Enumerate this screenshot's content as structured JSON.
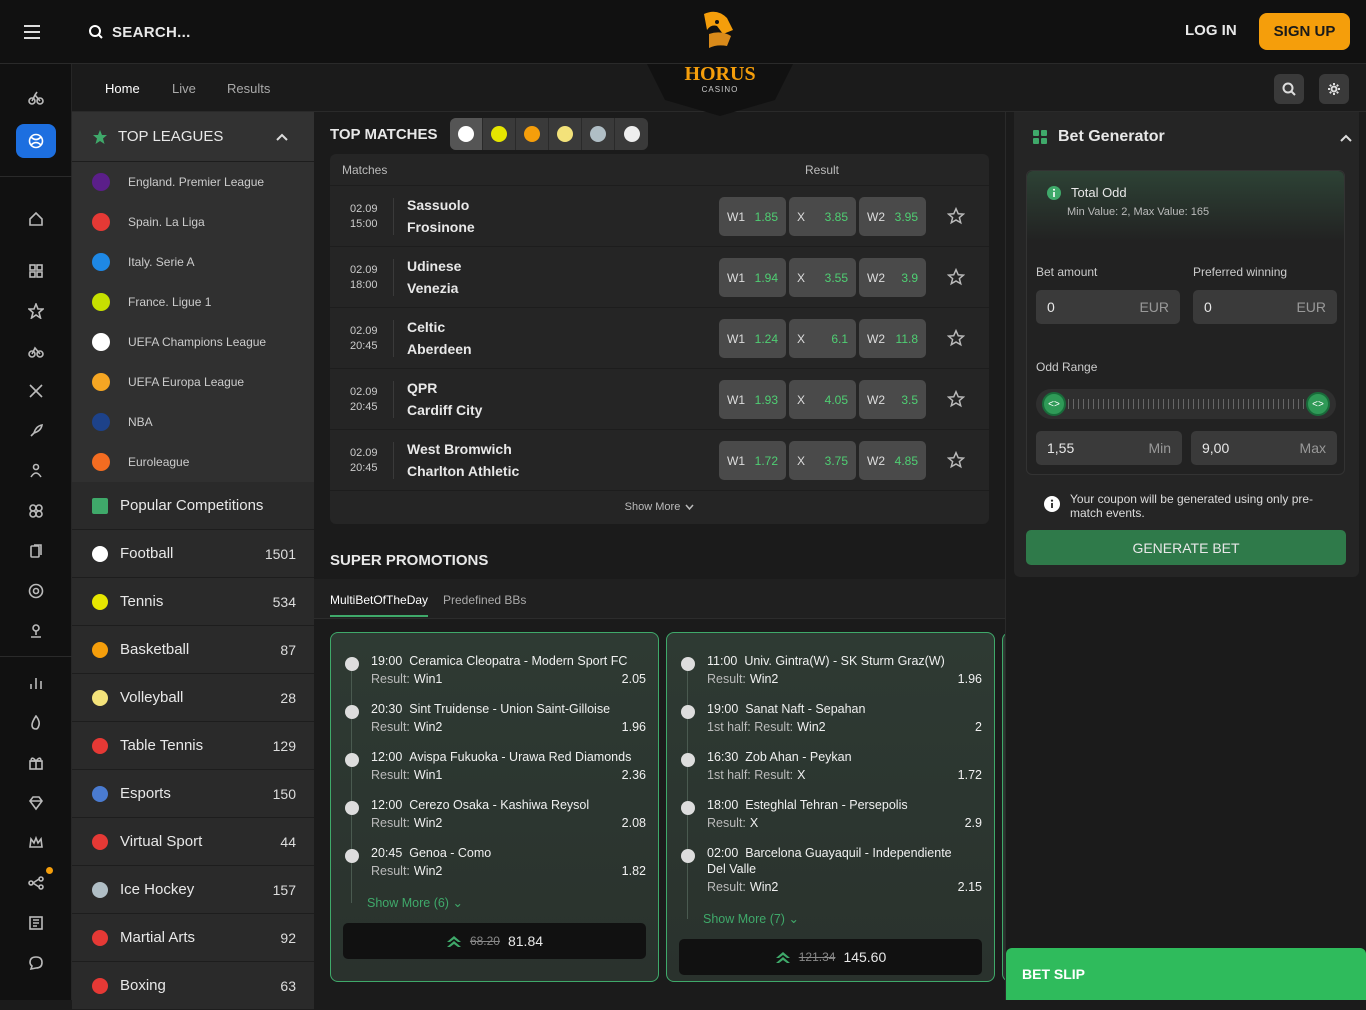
{
  "header": {
    "search_placeholder": "SEARCH...",
    "logo_text": "HORUS",
    "logo_sub": "CASINO",
    "login": "LOG IN",
    "signup": "SIGN UP"
  },
  "subnav": {
    "tabs": [
      "Home",
      "Live",
      "Results"
    ]
  },
  "top_leagues": {
    "title": "TOP LEAGUES",
    "items": [
      {
        "label": "England. Premier League",
        "color": "#5b1f8a"
      },
      {
        "label": "Spain. La Liga",
        "color": "#e53935"
      },
      {
        "label": "Italy. Serie A",
        "color": "#1e88e5"
      },
      {
        "label": "France. Ligue 1",
        "color": "#c6e000"
      },
      {
        "label": "UEFA Champions League",
        "color": "#ffffff"
      },
      {
        "label": "UEFA Europa League",
        "color": "#f5a623"
      },
      {
        "label": "NBA",
        "color": "#1d428a"
      },
      {
        "label": "Euroleague",
        "color": "#f36c21"
      }
    ]
  },
  "categories": [
    {
      "label": "Popular Competitions",
      "count": "",
      "color": "#3fa96a"
    },
    {
      "label": "Football",
      "count": "1501",
      "color": "#ffffff"
    },
    {
      "label": "Tennis",
      "count": "534",
      "color": "#e6e600"
    },
    {
      "label": "Basketball",
      "count": "87",
      "color": "#f59e0b"
    },
    {
      "label": "Volleyball",
      "count": "28",
      "color": "#f3e27a"
    },
    {
      "label": "Table Tennis",
      "count": "129",
      "color": "#e53935"
    },
    {
      "label": "Esports",
      "count": "150",
      "color": "#4a7bd0"
    },
    {
      "label": "Virtual Sport",
      "count": "44",
      "color": "#e53935"
    },
    {
      "label": "Ice Hockey",
      "count": "157",
      "color": "#b0bec5"
    },
    {
      "label": "Martial Arts",
      "count": "92",
      "color": "#e53935"
    },
    {
      "label": "Boxing",
      "count": "63",
      "color": "#e53935"
    }
  ],
  "top_matches": {
    "title": "TOP MATCHES",
    "col_matches": "Matches",
    "col_result": "Result",
    "show_more": "Show More",
    "matches": [
      {
        "date": "02.09",
        "time": "15:00",
        "home": "Sassuolo",
        "away": "Frosinone",
        "w1": "1.85",
        "x": "3.85",
        "w2": "3.95"
      },
      {
        "date": "02.09",
        "time": "18:00",
        "home": "Udinese",
        "away": "Venezia",
        "w1": "1.94",
        "x": "3.55",
        "w2": "3.9"
      },
      {
        "date": "02.09",
        "time": "20:45",
        "home": "Celtic",
        "away": "Aberdeen",
        "w1": "1.24",
        "x": "6.1",
        "w2": "11.8"
      },
      {
        "date": "02.09",
        "time": "20:45",
        "home": "QPR",
        "away": "Cardiff City",
        "w1": "1.93",
        "x": "4.05",
        "w2": "3.5"
      },
      {
        "date": "02.09",
        "time": "20:45",
        "home": "West Bromwich",
        "away": "Charlton Athletic",
        "w1": "1.72",
        "x": "3.75",
        "w2": "4.85"
      }
    ],
    "labels": {
      "w1": "W1",
      "x": "X",
      "w2": "W2"
    }
  },
  "promotions": {
    "title": "SUPER PROMOTIONS",
    "tabs": [
      "MultiBetOfTheDay",
      "Predefined BBs"
    ],
    "result_label": "Result:",
    "half_label": "1st half: Result:",
    "cards": [
      {
        "items": [
          {
            "time": "19:00",
            "match": "Ceramica Cleopatra - Modern Sport FC",
            "kind": "Result:",
            "pick": "Win1",
            "odd": "2.05"
          },
          {
            "time": "20:30",
            "match": "Sint Truidense - Union Saint-Gilloise",
            "kind": "Result:",
            "pick": "Win2",
            "odd": "1.96"
          },
          {
            "time": "12:00",
            "match": "Avispa Fukuoka - Urawa Red Diamonds",
            "kind": "Result:",
            "pick": "Win1",
            "odd": "2.36"
          },
          {
            "time": "12:00",
            "match": "Cerezo Osaka - Kashiwa Reysol",
            "kind": "Result:",
            "pick": "Win2",
            "odd": "2.08"
          },
          {
            "time": "20:45",
            "match": "Genoa - Como",
            "kind": "Result:",
            "pick": "Win2",
            "odd": "1.82"
          }
        ],
        "show_more": "Show More (6)",
        "old_total": "68.20",
        "new_total": "81.84"
      },
      {
        "items": [
          {
            "time": "11:00",
            "match": "Univ. Gintra(W) - SK Sturm Graz(W)",
            "kind": "Result:",
            "pick": "Win2",
            "odd": "1.96"
          },
          {
            "time": "19:00",
            "match": "Sanat Naft - Sepahan",
            "kind": "1st half: Result:",
            "pick": "Win2",
            "odd": "2"
          },
          {
            "time": "16:30",
            "match": "Zob Ahan - Peykan",
            "kind": "1st half: Result:",
            "pick": "X",
            "odd": "1.72"
          },
          {
            "time": "18:00",
            "match": "Esteghlal Tehran - Persepolis",
            "kind": "Result:",
            "pick": "X",
            "odd": "2.9"
          },
          {
            "time": "02:00",
            "match": "Barcelona Guayaquil - Independiente",
            "match2": "Del Valle",
            "kind": "Result:",
            "pick": "Win2",
            "odd": "2.15"
          }
        ],
        "show_more": "Show More (7)",
        "old_total": "121.34",
        "new_total": "145.60"
      }
    ]
  },
  "bet_generator": {
    "title": "Bet Generator",
    "total_odd": "Total Odd",
    "min_max": "Min Value: 2, Max Value: 165",
    "bet_amount_label": "Bet amount",
    "bet_amount_value": "0",
    "preferred_label": "Preferred winning",
    "preferred_value": "0",
    "currency": "EUR",
    "odd_range_label": "Odd Range",
    "range_min_value": "1,55",
    "range_min_unit": "Min",
    "range_max_value": "9,00",
    "range_max_unit": "Max",
    "info": "Your coupon will be generated using only pre-match events.",
    "generate": "GENERATE BET"
  },
  "bet_slip": "BET SLIP",
  "colors": {
    "accent": "#f59e0b",
    "green": "#3fa96a",
    "odd_green": "#4fcf73",
    "blue": "#1d6fe0"
  }
}
